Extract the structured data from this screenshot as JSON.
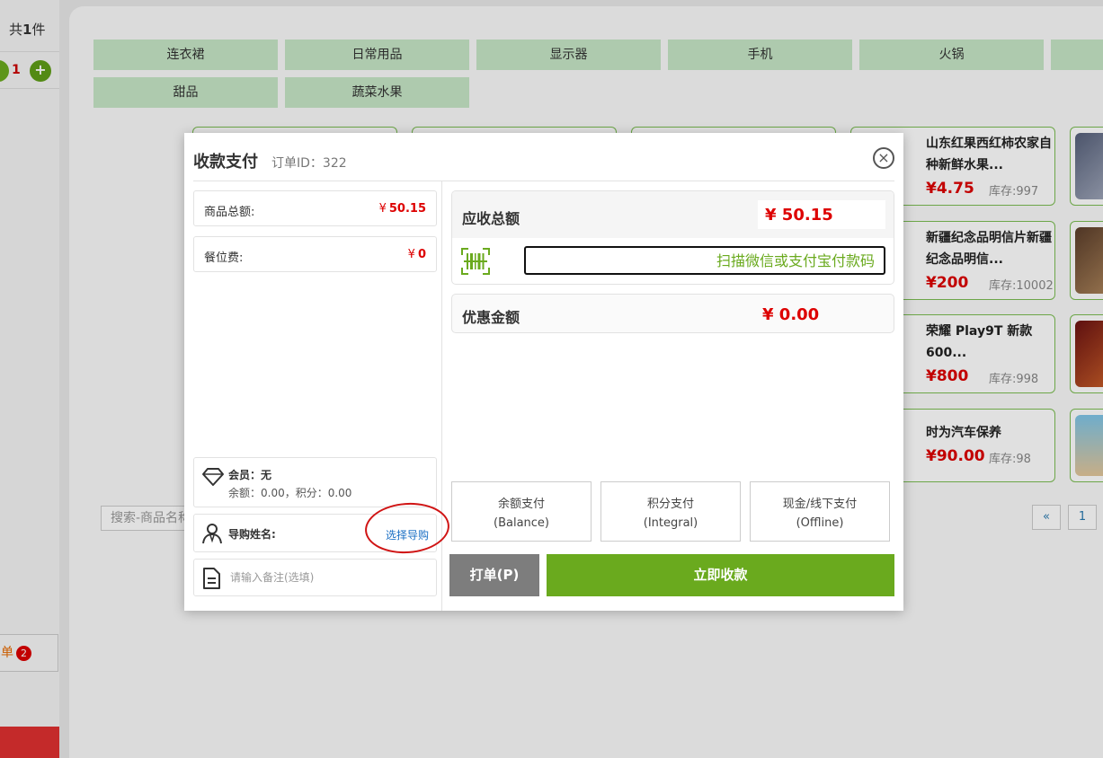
{
  "background": {
    "cart": {
      "prefix": "共",
      "count": "1",
      "suffix": "件"
    },
    "qty_value": "1",
    "qty_plus": "+",
    "hang_order": {
      "label": "单",
      "badge": "2"
    },
    "categories": [
      "连衣裙",
      "日常用品",
      "显示器",
      "手机",
      "火锅",
      "甜品",
      "蔬菜水果"
    ],
    "search_placeholder": "搜索-商品名称",
    "pager": {
      "prev": "«",
      "page": "1"
    },
    "products": [
      {
        "name": "山东红果西红柿农家自种新鲜水果...",
        "price": "¥4.75",
        "stock": "库存:997"
      },
      {
        "name": "新疆纪念品明信片新疆纪念品明信...",
        "price": "¥200",
        "stock": "库存:10002"
      },
      {
        "name": "荣耀 Play9T 新款600...",
        "price": "¥800",
        "stock": "库存:998"
      },
      {
        "name": "时为汽车保养",
        "price": "¥90.00",
        "stock": "库存:98"
      }
    ]
  },
  "modal": {
    "title": "收款支付",
    "order_id": "订单ID：322",
    "close_symbol": "×",
    "goods_total": {
      "label": "商品总额:",
      "currency": "¥",
      "value": "50.15"
    },
    "seat_fee": {
      "label": "餐位费:",
      "currency": "¥",
      "value": "0"
    },
    "member": {
      "name": "会员：无",
      "balance": "余额：0.00，积分：0.00"
    },
    "guide": {
      "label": "导购姓名:",
      "link": "选择导购"
    },
    "remark_placeholder": "请输入备注(选填)",
    "receivable": {
      "label": "应收总额",
      "value": "¥ 50.15"
    },
    "pay_code_placeholder": "扫描微信或支付宝付款码",
    "discount": {
      "label": "优惠金额",
      "value": "¥ 0.00"
    },
    "pay_methods": [
      {
        "line1": "余额支付",
        "line2": "(Balance)"
      },
      {
        "line1": "积分支付",
        "line2": "(Integral)"
      },
      {
        "line1": "现金/线下支付",
        "line2": "(Offline)"
      }
    ],
    "print_button": "打单(P)",
    "pay_now_button": "立即收款"
  },
  "colors": {
    "accent_green": "#6aaa1e",
    "price_red": "#dd0000",
    "category_bg": "#c6e6c6",
    "link_blue": "#1a6fc4",
    "annotation_red": "#d01414"
  }
}
